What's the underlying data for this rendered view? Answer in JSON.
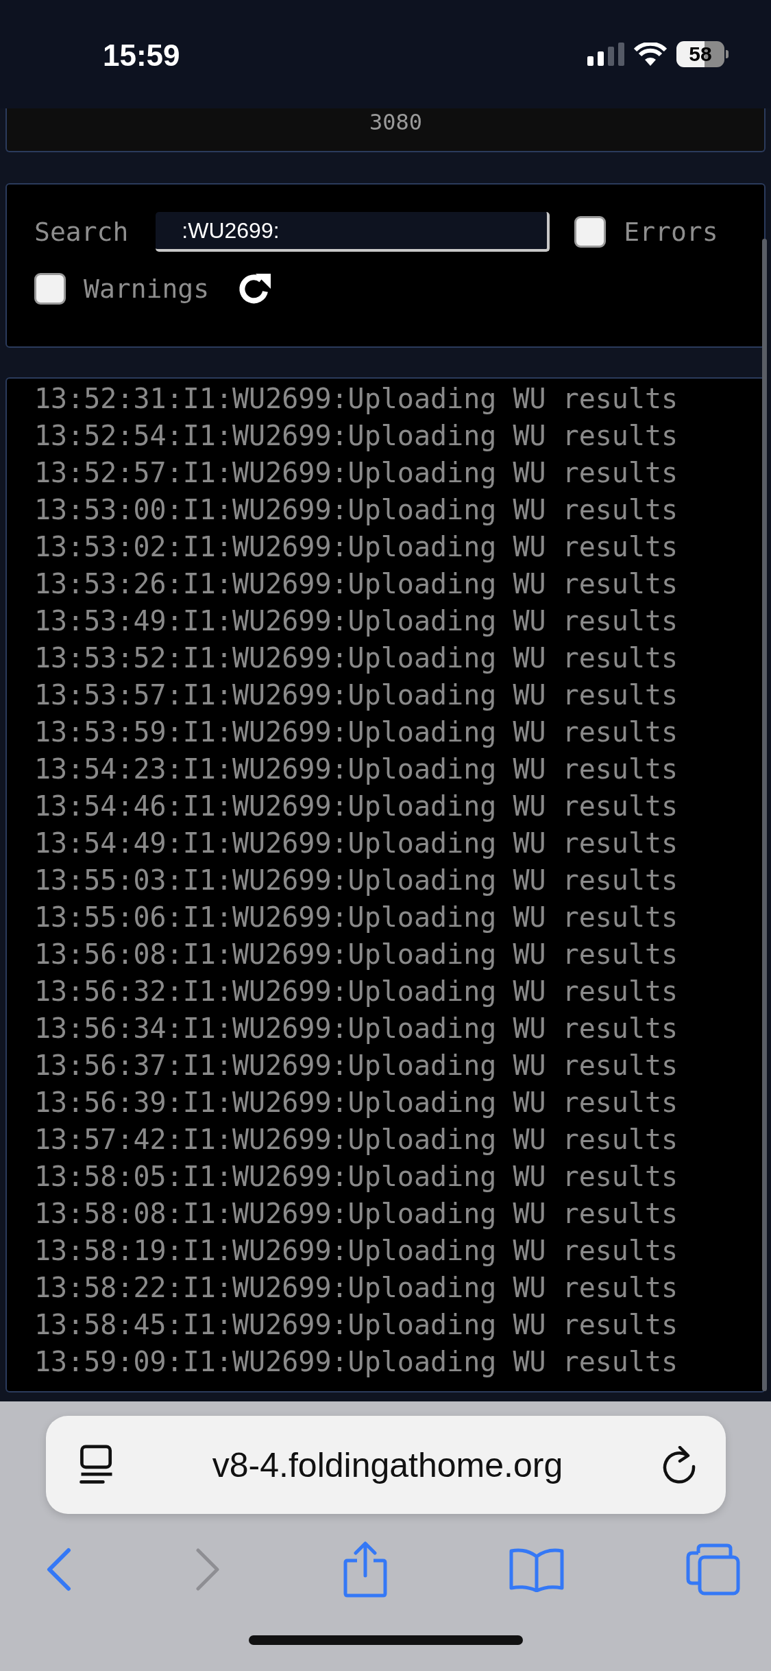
{
  "status_bar": {
    "time": "15:59",
    "battery": "58"
  },
  "top_card": {
    "text": "3080"
  },
  "filters": {
    "search_label": "Search",
    "search_value": ":WU2699:",
    "checkboxes": [
      {
        "label": "Errors",
        "checked": false
      },
      {
        "label": "Warnings",
        "checked": false
      }
    ]
  },
  "log_lines": [
    "13:52:31:I1:WU2699:Uploading WU results",
    "13:52:54:I1:WU2699:Uploading WU results",
    "13:52:57:I1:WU2699:Uploading WU results",
    "13:53:00:I1:WU2699:Uploading WU results",
    "13:53:02:I1:WU2699:Uploading WU results",
    "13:53:26:I1:WU2699:Uploading WU results",
    "13:53:49:I1:WU2699:Uploading WU results",
    "13:53:52:I1:WU2699:Uploading WU results",
    "13:53:57:I1:WU2699:Uploading WU results",
    "13:53:59:I1:WU2699:Uploading WU results",
    "13:54:23:I1:WU2699:Uploading WU results",
    "13:54:46:I1:WU2699:Uploading WU results",
    "13:54:49:I1:WU2699:Uploading WU results",
    "13:55:03:I1:WU2699:Uploading WU results",
    "13:55:06:I1:WU2699:Uploading WU results",
    "13:56:08:I1:WU2699:Uploading WU results",
    "13:56:32:I1:WU2699:Uploading WU results",
    "13:56:34:I1:WU2699:Uploading WU results",
    "13:56:37:I1:WU2699:Uploading WU results",
    "13:56:39:I1:WU2699:Uploading WU results",
    "13:57:42:I1:WU2699:Uploading WU results",
    "13:58:05:I1:WU2699:Uploading WU results",
    "13:58:08:I1:WU2699:Uploading WU results",
    "13:58:19:I1:WU2699:Uploading WU results",
    "13:58:22:I1:WU2699:Uploading WU results",
    "13:58:45:I1:WU2699:Uploading WU results",
    "13:59:09:I1:WU2699:Uploading WU results"
  ],
  "browser": {
    "url": "v8-4.foldingathome.org"
  }
}
